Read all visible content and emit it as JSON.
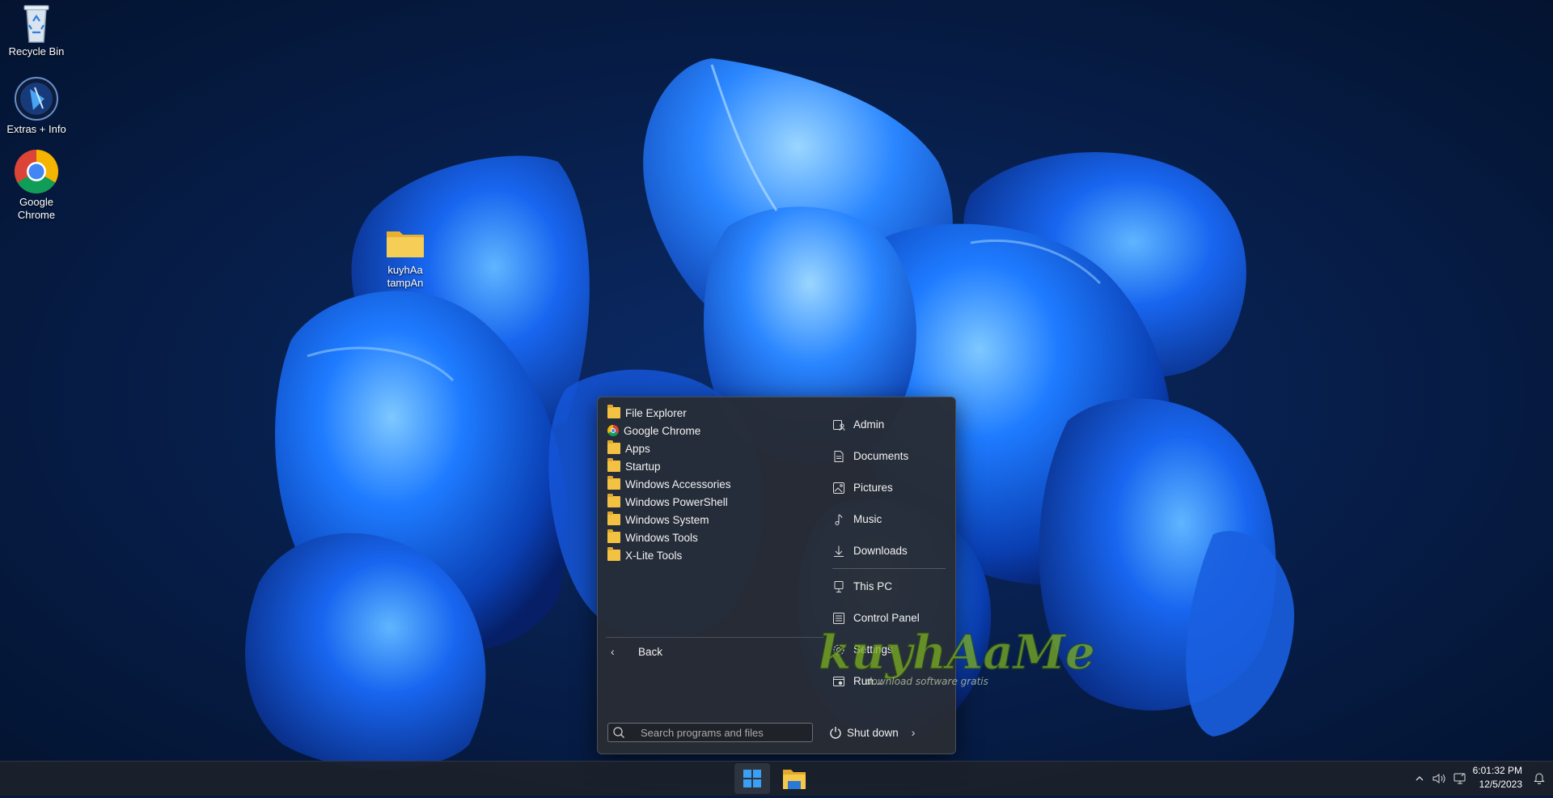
{
  "desktop": {
    "icons": [
      {
        "label": "Recycle Bin"
      },
      {
        "label": "Extras + Info"
      },
      {
        "label_line1": "Google",
        "label_line2": "Chrome"
      },
      {
        "label_line1": "kuyhAa",
        "label_line2": "tampAn"
      }
    ]
  },
  "start_menu": {
    "programs": [
      {
        "label": "File Explorer",
        "icon": "file-explorer-icon"
      },
      {
        "label": "Google Chrome",
        "icon": "chrome-icon"
      },
      {
        "label": "Apps",
        "icon": "folder-icon"
      },
      {
        "label": "Startup",
        "icon": "folder-icon"
      },
      {
        "label": "Windows Accessories",
        "icon": "folder-icon"
      },
      {
        "label": "Windows PowerShell",
        "icon": "folder-icon"
      },
      {
        "label": "Windows System",
        "icon": "folder-icon"
      },
      {
        "label": "Windows Tools",
        "icon": "folder-icon"
      },
      {
        "label": "X-Lite Tools",
        "icon": "folder-icon"
      }
    ],
    "places": [
      {
        "label": "Admin",
        "icon": "user-folder-icon"
      },
      {
        "label": "Documents",
        "icon": "document-icon"
      },
      {
        "label": "Pictures",
        "icon": "picture-icon"
      },
      {
        "label": "Music",
        "icon": "music-note-icon"
      },
      {
        "label": "Downloads",
        "icon": "download-icon"
      }
    ],
    "system": [
      {
        "label": "This PC",
        "icon": "computer-icon"
      },
      {
        "label": "Control Panel",
        "icon": "control-panel-icon"
      },
      {
        "label": "Settings",
        "icon": "gear-icon"
      },
      {
        "label": "Run...",
        "icon": "run-icon"
      }
    ],
    "back_label": "Back",
    "search_placeholder": "Search programs and files",
    "shutdown_label": "Shut down"
  },
  "watermark": {
    "title": "kuyhAaMe",
    "subtitle": "download software gratis"
  },
  "taskbar": {
    "time": "6:01:32 PM",
    "date": "12/5/2023"
  },
  "colors": {
    "folder": "#f3c242",
    "menu_bg": "#282c34",
    "taskbar_bg": "#1c212a",
    "accent_blue": "#2d8cff"
  }
}
